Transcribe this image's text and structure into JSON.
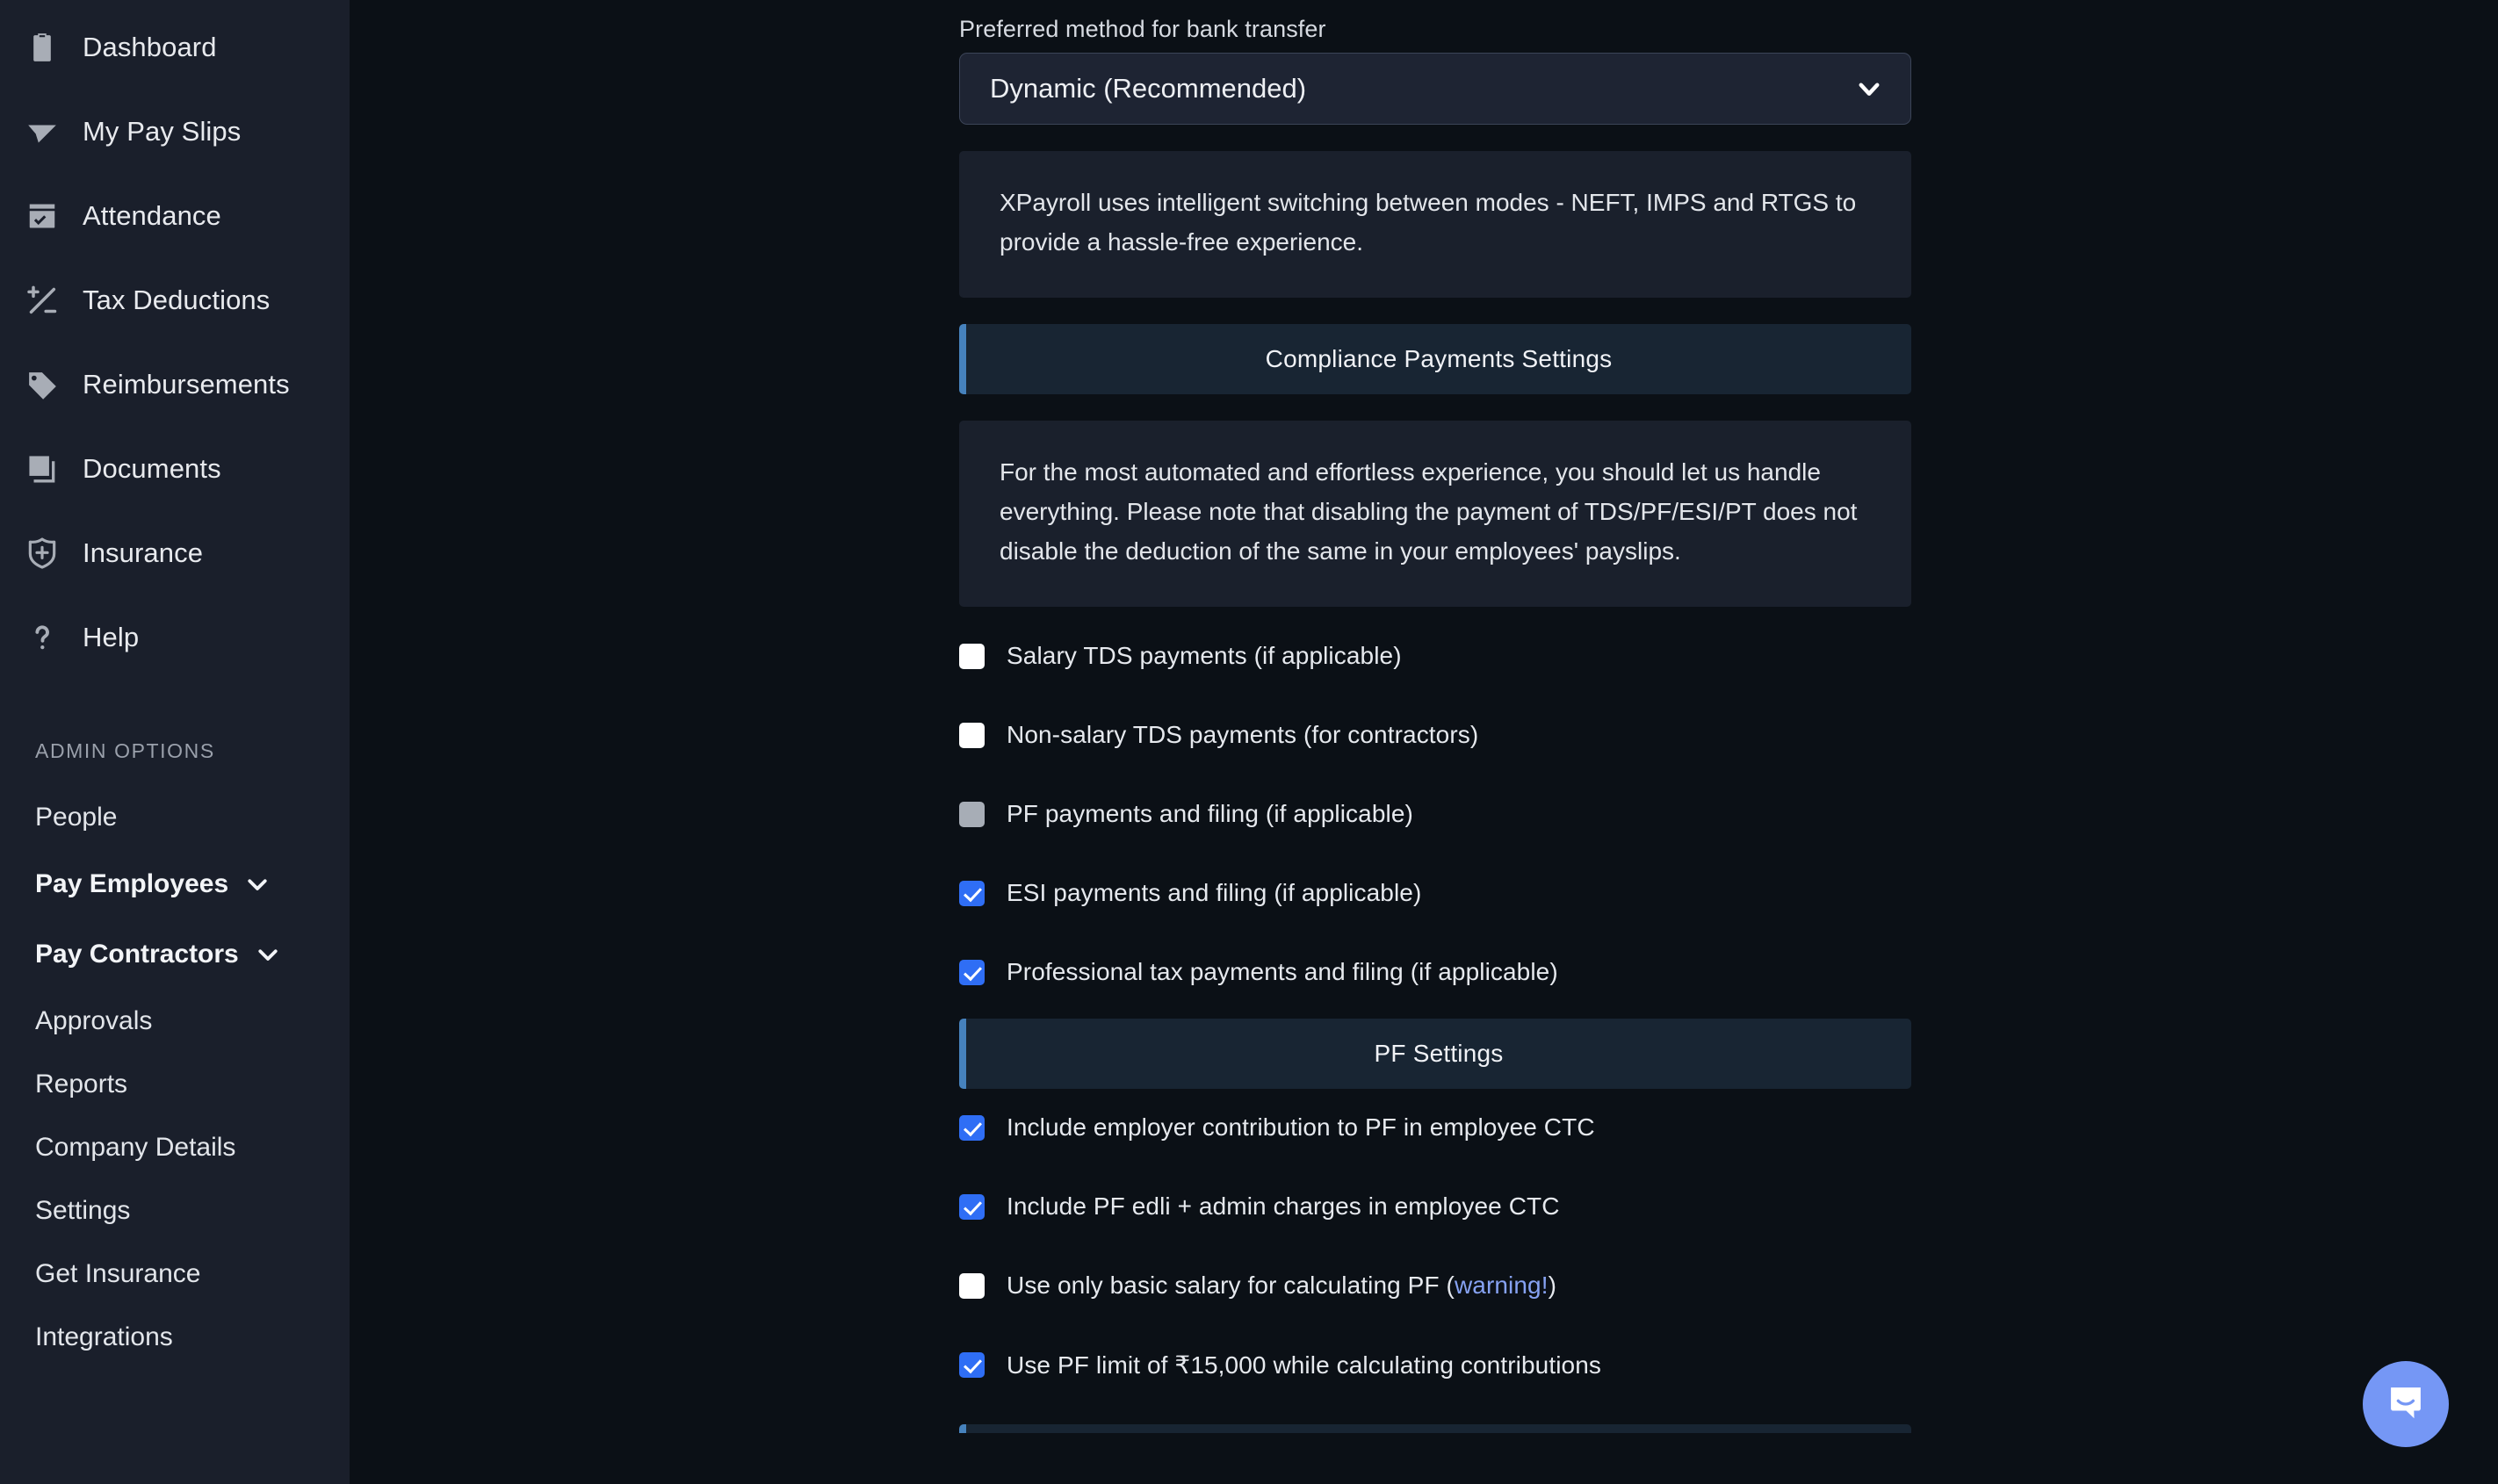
{
  "sidebar": {
    "nav_items": [
      {
        "label": "Dashboard",
        "icon": "clipboard-icon"
      },
      {
        "label": "My Pay Slips",
        "icon": "paper-plane-icon"
      },
      {
        "label": "Attendance",
        "icon": "calendar-check-icon"
      },
      {
        "label": "Tax Deductions",
        "icon": "plus-minus-icon"
      },
      {
        "label": "Reimbursements",
        "icon": "tag-icon"
      },
      {
        "label": "Documents",
        "icon": "documents-icon"
      },
      {
        "label": "Insurance",
        "icon": "shield-plus-icon"
      },
      {
        "label": "Help",
        "icon": "question-mark-icon"
      }
    ],
    "admin_section_title": "ADMIN OPTIONS",
    "admin_items": [
      {
        "label": "People",
        "bold": false,
        "chevron": false
      },
      {
        "label": "Pay Employees",
        "bold": true,
        "chevron": true
      },
      {
        "label": "Pay Contractors",
        "bold": true,
        "chevron": true
      },
      {
        "label": "Approvals",
        "bold": false,
        "chevron": false
      },
      {
        "label": "Reports",
        "bold": false,
        "chevron": false
      },
      {
        "label": "Company Details",
        "bold": false,
        "chevron": false
      },
      {
        "label": "Settings",
        "bold": false,
        "chevron": false
      },
      {
        "label": "Get Insurance",
        "bold": false,
        "chevron": false
      },
      {
        "label": "Integrations",
        "bold": false,
        "chevron": false
      }
    ]
  },
  "main": {
    "bank_transfer": {
      "label": "Preferred method for bank transfer",
      "selected": "Dynamic (Recommended)",
      "chevron_icon": "chevron-down-icon",
      "info": "XPayroll uses intelligent switching between modes - NEFT, IMPS and RTGS to provide a hassle-free experience."
    },
    "compliance": {
      "header": "Compliance Payments Settings",
      "info": "For the most automated and effortless experience, you should let us handle everything. Please note that disabling the payment of TDS/PF/ESI/PT does not disable the deduction of the same in your employees' payslips.",
      "checkboxes": [
        {
          "label": "Salary TDS payments (if applicable)",
          "state": "unchecked"
        },
        {
          "label": "Non-salary TDS payments (for contractors)",
          "state": "unchecked"
        },
        {
          "label": "PF payments and filing (if applicable)",
          "state": "disabled"
        },
        {
          "label": "ESI payments and filing (if applicable)",
          "state": "checked"
        },
        {
          "label": "Professional tax payments and filing (if applicable)",
          "state": "checked"
        }
      ]
    },
    "pf_settings": {
      "header": "PF Settings",
      "checkboxes": [
        {
          "label": "Include employer contribution to PF in employee CTC",
          "state": "checked",
          "suffix": "",
          "link": ""
        },
        {
          "label": "Include PF edli + admin charges in employee CTC",
          "state": "checked",
          "suffix": "",
          "link": ""
        },
        {
          "label": "Use only basic salary for calculating PF (",
          "state": "unchecked",
          "suffix": ")",
          "link": "warning!"
        },
        {
          "label": "Use PF limit of ₹15,000 while calculating contributions",
          "state": "checked",
          "suffix": "",
          "link": ""
        }
      ]
    }
  },
  "chat": {
    "icon": "chat-bubble-icon",
    "color": "#7597f5"
  }
}
